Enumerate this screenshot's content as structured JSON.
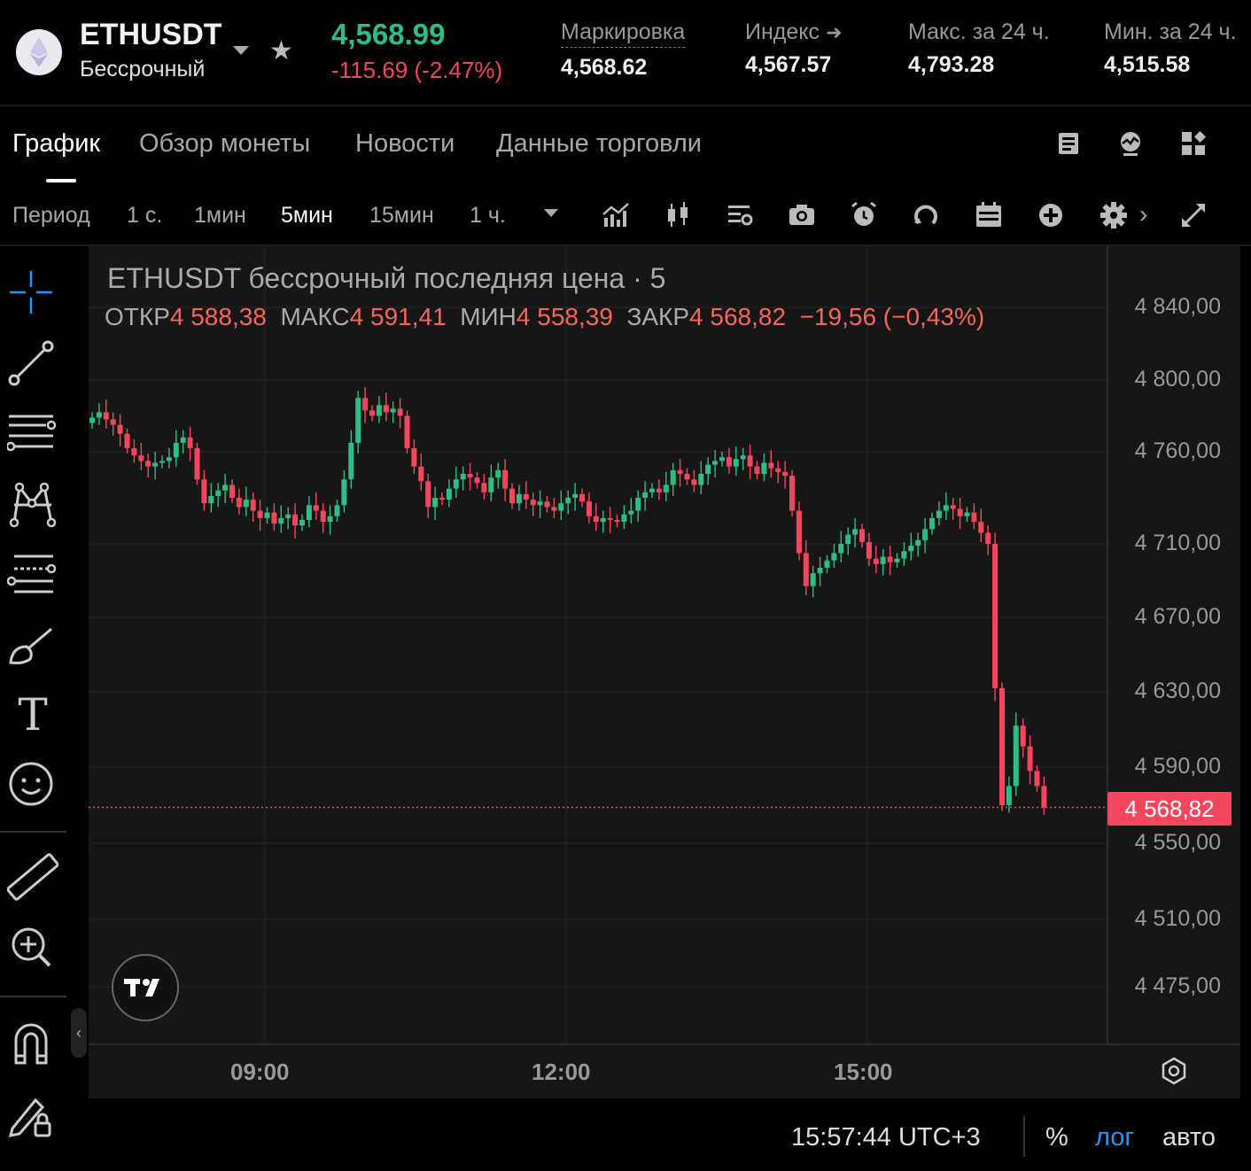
{
  "header": {
    "symbol": "ETHUSDT",
    "contract_type": "Бессрочный",
    "last_price": "4,568.99",
    "change_abs": "-115.69",
    "change_pct": "(-2.47%)",
    "stats": [
      {
        "label": "Маркировка",
        "value": "4,568.62"
      },
      {
        "label": "Индекс",
        "value": "4,567.57"
      },
      {
        "label": "Макс. за 24 ч.",
        "value": "4,793.28"
      },
      {
        "label": "Мин. за 24 ч.",
        "value": "4,515.58"
      }
    ]
  },
  "tabs": [
    "График",
    "Обзор монеты",
    "Новости",
    "Данные торговли"
  ],
  "toolbar": {
    "period_label": "Период",
    "intervals": [
      "1 с.",
      "1мин",
      "5мин",
      "15мин",
      "1 ч."
    ],
    "active_interval": "5мин"
  },
  "chart": {
    "title": "ETHUSDT бессрочный последняя цена · 5",
    "ohlc": {
      "open_label": "ОТКР",
      "open": "4 588,38",
      "high_label": "МАКС",
      "high": "4 591,41",
      "low_label": "МИН",
      "low": "4 558,39",
      "close_label": "ЗАКР",
      "close": "4 568,82",
      "change": "−19,56 (−0,43%)"
    },
    "current_price_label": "4 568,82",
    "y_ticks": [
      "4 840,00",
      "4 800,00",
      "4 760,00",
      "4 710,00",
      "4 670,00",
      "4 630,00",
      "4 590,00",
      "4 550,00",
      "4 510,00",
      "4 475,00"
    ],
    "x_ticks": [
      "09:00",
      "12:00",
      "15:00"
    ]
  },
  "chart_data": {
    "type": "candlestick",
    "title": "ETHUSDT бессрочный последняя цена · 5",
    "up_color": "#2ebd85",
    "down_color": "#f6465d",
    "y_ticks": [
      4840,
      4800,
      4760,
      4710,
      4670,
      4630,
      4590,
      4550,
      4510,
      4475
    ],
    "x_ticks": [
      "09:00",
      "12:00",
      "15:00"
    ],
    "current_price": 4568.82,
    "series_close": [
      4779,
      4782,
      4778,
      4775,
      4770,
      4762,
      4758,
      4755,
      4752,
      4754,
      4755,
      4757,
      4765,
      4768,
      4762,
      4745,
      4732,
      4736,
      4739,
      4742,
      4735,
      4730,
      4734,
      4728,
      4724,
      4727,
      4721,
      4724,
      4726,
      4720,
      4723,
      4731,
      4728,
      4722,
      4725,
      4731,
      4745,
      4765,
      4790,
      4783,
      4780,
      4786,
      4782,
      4784,
      4780,
      4762,
      4752,
      4744,
      4730,
      4735,
      4734,
      4740,
      4745,
      4748,
      4746,
      4743,
      4738,
      4746,
      4750,
      4740,
      4732,
      4737,
      4734,
      4731,
      4733,
      4730,
      4728,
      4732,
      4735,
      4737,
      4733,
      4725,
      4722,
      4724,
      4723,
      4722,
      4726,
      4728,
      4735,
      4738,
      4740,
      4738,
      4742,
      4750,
      4748,
      4745,
      4742,
      4748,
      4753,
      4755,
      4757,
      4752,
      4756,
      4758,
      4752,
      4748,
      4754,
      4751,
      4749,
      4747,
      4728,
      4705,
      4687,
      4694,
      4697,
      4701,
      4705,
      4710,
      4715,
      4718,
      4711,
      4702,
      4699,
      4703,
      4700,
      4702,
      4706,
      4709,
      4712,
      4718,
      4724,
      4728,
      4731,
      4729,
      4725,
      4727,
      4722,
      4716,
      4710,
      4632,
      4570,
      4580,
      4612,
      4601,
      4588,
      4580,
      4568.82
    ]
  },
  "footer": {
    "clock": "15:57:44 UTC+3",
    "percent": "%",
    "log": "лог",
    "auto": "авто"
  },
  "colors": {
    "up": "#2ebd85",
    "down": "#f6465d",
    "accent": "#2196f3"
  }
}
